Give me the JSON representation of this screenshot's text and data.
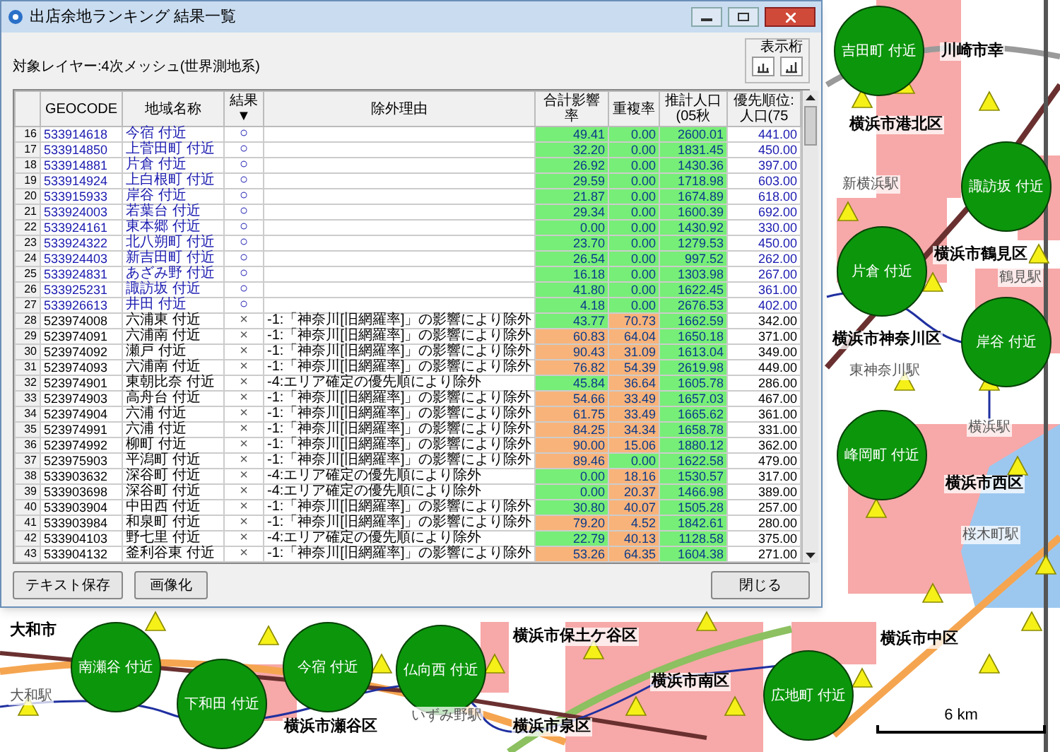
{
  "window": {
    "title": "出店余地ランキング 結果一覧"
  },
  "layer_label": "対象レイヤー:4次メッシュ(世界測地系)",
  "digits_group": {
    "label": "表示桁"
  },
  "table": {
    "columns": [
      "GEOCODE",
      "地域名称",
      "結果▼",
      "除外理由",
      "合計影響率",
      "重複率",
      "推計人口(05秋",
      "優先順位:人口(75"
    ],
    "rows": [
      {
        "no": "16",
        "kind": "adopted",
        "geocode": "533914618",
        "name": "今宿 付近",
        "result": "○",
        "impact": {
          "text": "49.41",
          "color": "#77ee77"
        },
        "overlap": {
          "text": "0.00",
          "color": "#77ee77"
        },
        "population": {
          "text": "2600.01",
          "color": "#77ee77"
        },
        "rank": "441.00"
      },
      {
        "no": "17",
        "kind": "adopted",
        "geocode": "533914850",
        "name": "上菅田町 付近",
        "result": "○",
        "impact": {
          "text": "32.20",
          "color": "#77ee77"
        },
        "overlap": {
          "text": "0.00",
          "color": "#77ee77"
        },
        "population": {
          "text": "1831.45",
          "color": "#77ee77"
        },
        "rank": "450.00"
      },
      {
        "no": "18",
        "kind": "adopted",
        "geocode": "533914881",
        "name": "片倉 付近",
        "result": "○",
        "impact": {
          "text": "26.92",
          "color": "#77ee77"
        },
        "overlap": {
          "text": "0.00",
          "color": "#77ee77"
        },
        "population": {
          "text": "1430.36",
          "color": "#77ee77"
        },
        "rank": "397.00"
      },
      {
        "no": "19",
        "kind": "adopted",
        "geocode": "533914924",
        "name": "上白根町 付近",
        "result": "○",
        "impact": {
          "text": "29.59",
          "color": "#77ee77"
        },
        "overlap": {
          "text": "0.00",
          "color": "#77ee77"
        },
        "population": {
          "text": "1718.98",
          "color": "#77ee77"
        },
        "rank": "603.00"
      },
      {
        "no": "20",
        "kind": "adopted",
        "geocode": "533915933",
        "name": "岸谷 付近",
        "result": "○",
        "impact": {
          "text": "21.87",
          "color": "#77ee77"
        },
        "overlap": {
          "text": "0.00",
          "color": "#77ee77"
        },
        "population": {
          "text": "1674.89",
          "color": "#77ee77"
        },
        "rank": "618.00"
      },
      {
        "no": "21",
        "kind": "adopted",
        "geocode": "533924003",
        "name": "若葉台 付近",
        "result": "○",
        "impact": {
          "text": "29.34",
          "color": "#77ee77"
        },
        "overlap": {
          "text": "0.00",
          "color": "#77ee77"
        },
        "population": {
          "text": "1600.39",
          "color": "#77ee77"
        },
        "rank": "692.00"
      },
      {
        "no": "22",
        "kind": "adopted",
        "geocode": "533924161",
        "name": "東本郷 付近",
        "result": "○",
        "impact": {
          "text": "0.00",
          "color": "#77ee77"
        },
        "overlap": {
          "text": "0.00",
          "color": "#77ee77"
        },
        "population": {
          "text": "1430.92",
          "color": "#77ee77"
        },
        "rank": "330.00"
      },
      {
        "no": "23",
        "kind": "adopted",
        "geocode": "533924322",
        "name": "北八朔町 付近",
        "result": "○",
        "impact": {
          "text": "23.70",
          "color": "#77ee77"
        },
        "overlap": {
          "text": "0.00",
          "color": "#77ee77"
        },
        "population": {
          "text": "1279.53",
          "color": "#77ee77"
        },
        "rank": "450.00"
      },
      {
        "no": "24",
        "kind": "adopted",
        "geocode": "533924403",
        "name": "新吉田町 付近",
        "result": "○",
        "impact": {
          "text": "26.54",
          "color": "#77ee77"
        },
        "overlap": {
          "text": "0.00",
          "color": "#77ee77"
        },
        "population": {
          "text": "997.52",
          "color": "#77ee77"
        },
        "rank": "262.00"
      },
      {
        "no": "25",
        "kind": "adopted",
        "geocode": "533924831",
        "name": "あざみ野 付近",
        "result": "○",
        "impact": {
          "text": "16.18",
          "color": "#77ee77"
        },
        "overlap": {
          "text": "0.00",
          "color": "#77ee77"
        },
        "population": {
          "text": "1303.98",
          "color": "#77ee77"
        },
        "rank": "267.00"
      },
      {
        "no": "26",
        "kind": "adopted",
        "geocode": "533925231",
        "name": "諏訪坂 付近",
        "result": "○",
        "impact": {
          "text": "41.80",
          "color": "#77ee77"
        },
        "overlap": {
          "text": "0.00",
          "color": "#77ee77"
        },
        "population": {
          "text": "1622.45",
          "color": "#77ee77"
        },
        "rank": "361.00"
      },
      {
        "no": "27",
        "kind": "adopted",
        "geocode": "533926613",
        "name": "井田 付近",
        "result": "○",
        "impact": {
          "text": "4.18",
          "color": "#77ee77"
        },
        "overlap": {
          "text": "0.00",
          "color": "#77ee77"
        },
        "population": {
          "text": "2676.53",
          "color": "#77ee77"
        },
        "rank": "402.00"
      },
      {
        "no": "28",
        "kind": "excluded",
        "geocode": "523974008",
        "name": "六浦東 付近",
        "result": "×",
        "reason": "-1:「神奈川[旧網羅率]」の影響により除外",
        "impact": {
          "text": "43.77",
          "color": "#77ee77"
        },
        "overlap": {
          "text": "70.73",
          "color": "#f8b37a"
        },
        "population": {
          "text": "1662.59",
          "color": "#77ee77"
        },
        "rank": "342.00"
      },
      {
        "no": "29",
        "kind": "excluded",
        "geocode": "523974091",
        "name": "六浦南 付近",
        "result": "×",
        "reason": "-1:「神奈川[旧網羅率]」の影響により除外",
        "impact": {
          "text": "60.83",
          "color": "#f8b37a"
        },
        "overlap": {
          "text": "64.04",
          "color": "#f8b37a"
        },
        "population": {
          "text": "1650.18",
          "color": "#77ee77"
        },
        "rank": "371.00"
      },
      {
        "no": "30",
        "kind": "excluded",
        "geocode": "523974092",
        "name": "瀬戸 付近",
        "result": "×",
        "reason": "-1:「神奈川[旧網羅率]」の影響により除外",
        "impact": {
          "text": "90.43",
          "color": "#f8b37a"
        },
        "overlap": {
          "text": "31.09",
          "color": "#f8b37a"
        },
        "population": {
          "text": "1613.04",
          "color": "#77ee77"
        },
        "rank": "349.00"
      },
      {
        "no": "31",
        "kind": "excluded",
        "geocode": "523974093",
        "name": "六浦南 付近",
        "result": "×",
        "reason": "-1:「神奈川[旧網羅率]」の影響により除外",
        "impact": {
          "text": "76.82",
          "color": "#f8b37a"
        },
        "overlap": {
          "text": "54.39",
          "color": "#f8b37a"
        },
        "population": {
          "text": "2619.98",
          "color": "#77ee77"
        },
        "rank": "449.00"
      },
      {
        "no": "32",
        "kind": "excluded",
        "geocode": "523974901",
        "name": "東朝比奈 付近",
        "result": "×",
        "reason": "-4:エリア確定の優先順により除外",
        "impact": {
          "text": "45.84",
          "color": "#77ee77"
        },
        "overlap": {
          "text": "36.64",
          "color": "#f8b37a"
        },
        "population": {
          "text": "1605.78",
          "color": "#77ee77"
        },
        "rank": "286.00"
      },
      {
        "no": "33",
        "kind": "excluded",
        "geocode": "523974903",
        "name": "高舟台 付近",
        "result": "×",
        "reason": "-1:「神奈川[旧網羅率]」の影響により除外",
        "impact": {
          "text": "54.66",
          "color": "#f8b37a"
        },
        "overlap": {
          "text": "33.49",
          "color": "#f8b37a"
        },
        "population": {
          "text": "1657.03",
          "color": "#77ee77"
        },
        "rank": "467.00"
      },
      {
        "no": "34",
        "kind": "excluded",
        "geocode": "523974904",
        "name": "六浦 付近",
        "result": "×",
        "reason": "-1:「神奈川[旧網羅率]」の影響により除外",
        "impact": {
          "text": "61.75",
          "color": "#f8b37a"
        },
        "overlap": {
          "text": "33.49",
          "color": "#f8b37a"
        },
        "population": {
          "text": "1665.62",
          "color": "#77ee77"
        },
        "rank": "361.00"
      },
      {
        "no": "35",
        "kind": "excluded",
        "geocode": "523974991",
        "name": "六浦 付近",
        "result": "×",
        "reason": "-1:「神奈川[旧網羅率]」の影響により除外",
        "impact": {
          "text": "84.25",
          "color": "#f8b37a"
        },
        "overlap": {
          "text": "34.34",
          "color": "#f8b37a"
        },
        "population": {
          "text": "1658.78",
          "color": "#77ee77"
        },
        "rank": "331.00"
      },
      {
        "no": "36",
        "kind": "excluded",
        "geocode": "523974992",
        "name": "柳町 付近",
        "result": "×",
        "reason": "-1:「神奈川[旧網羅率]」の影響により除外",
        "impact": {
          "text": "90.00",
          "color": "#f8b37a"
        },
        "overlap": {
          "text": "15.06",
          "color": "#f8b37a"
        },
        "population": {
          "text": "1880.12",
          "color": "#77ee77"
        },
        "rank": "362.00"
      },
      {
        "no": "37",
        "kind": "excluded",
        "geocode": "523975903",
        "name": "平潟町 付近",
        "result": "×",
        "reason": "-1:「神奈川[旧網羅率]」の影響により除外",
        "impact": {
          "text": "89.46",
          "color": "#f8b37a"
        },
        "overlap": {
          "text": "0.00",
          "color": "#77ee77"
        },
        "population": {
          "text": "1622.58",
          "color": "#77ee77"
        },
        "rank": "479.00"
      },
      {
        "no": "38",
        "kind": "excluded",
        "geocode": "533903632",
        "name": "深谷町 付近",
        "result": "×",
        "reason": "-4:エリア確定の優先順により除外",
        "impact": {
          "text": "0.00",
          "color": "#77ee77"
        },
        "overlap": {
          "text": "18.16",
          "color": "#f8b37a"
        },
        "population": {
          "text": "1530.57",
          "color": "#77ee77"
        },
        "rank": "317.00"
      },
      {
        "no": "39",
        "kind": "excluded",
        "geocode": "533903698",
        "name": "深谷町 付近",
        "result": "×",
        "reason": "-4:エリア確定の優先順により除外",
        "impact": {
          "text": "0.00",
          "color": "#77ee77"
        },
        "overlap": {
          "text": "20.37",
          "color": "#f8b37a"
        },
        "population": {
          "text": "1466.98",
          "color": "#77ee77"
        },
        "rank": "389.00"
      },
      {
        "no": "40",
        "kind": "excluded",
        "geocode": "533903904",
        "name": "中田西 付近",
        "result": "×",
        "reason": "-1:「神奈川[旧網羅率]」の影響により除外",
        "impact": {
          "text": "30.80",
          "color": "#77ee77"
        },
        "overlap": {
          "text": "40.07",
          "color": "#f8b37a"
        },
        "population": {
          "text": "1505.28",
          "color": "#77ee77"
        },
        "rank": "257.00"
      },
      {
        "no": "41",
        "kind": "excluded",
        "geocode": "533903984",
        "name": "和泉町 付近",
        "result": "×",
        "reason": "-1:「神奈川[旧網羅率]」の影響により除外",
        "impact": {
          "text": "79.20",
          "color": "#f8b37a"
        },
        "overlap": {
          "text": "4.52",
          "color": "#f8b37a"
        },
        "population": {
          "text": "1842.61",
          "color": "#77ee77"
        },
        "rank": "280.00"
      },
      {
        "no": "42",
        "kind": "excluded",
        "geocode": "533904103",
        "name": "野七里 付近",
        "result": "×",
        "reason": "-4:エリア確定の優先順により除外",
        "impact": {
          "text": "22.79",
          "color": "#77ee77"
        },
        "overlap": {
          "text": "40.13",
          "color": "#f8b37a"
        },
        "population": {
          "text": "1128.58",
          "color": "#77ee77"
        },
        "rank": "375.00"
      },
      {
        "no": "43",
        "kind": "excluded",
        "geocode": "533904132",
        "name": "釜利谷東 付近",
        "result": "×",
        "reason": "-1:「神奈川[旧網羅率]」の影響により除外",
        "impact": {
          "text": "53.26",
          "color": "#f8b37a"
        },
        "overlap": {
          "text": "64.35",
          "color": "#f8b37a"
        },
        "population": {
          "text": "1604.38",
          "color": "#77ee77"
        },
        "rank": "271.00"
      }
    ]
  },
  "buttons": [
    "テキスト保存",
    "画像化",
    "閉じる"
  ],
  "map": {
    "area_markers": [
      "吉田町 付近",
      "諏訪坂 付近",
      "片倉 付近",
      "岸谷 付近",
      "峰岡町 付近",
      "南瀬谷 付近",
      "下和田 付近",
      "今宿 付近",
      "仏向西 付近",
      "広地町 付近"
    ],
    "labels": [
      {
        "text": "川崎市幸",
        "kind": "district"
      },
      {
        "text": "横浜市港北区",
        "kind": "district"
      },
      {
        "text": "新横浜駅",
        "kind": "station"
      },
      {
        "text": "横浜市鶴見区",
        "kind": "district"
      },
      {
        "text": "鶴見駅",
        "kind": "station"
      },
      {
        "text": "横浜市神奈川区",
        "kind": "district"
      },
      {
        "text": "東神奈川駅",
        "kind": "station"
      },
      {
        "text": "横浜駅",
        "kind": "station"
      },
      {
        "text": "横浜市西区",
        "kind": "district"
      },
      {
        "text": "桜木町駅",
        "kind": "station"
      },
      {
        "text": "大和市",
        "kind": "district"
      },
      {
        "text": "大和駅",
        "kind": "station"
      },
      {
        "text": "横浜市瀬谷区",
        "kind": "district"
      },
      {
        "text": "いずみ野駅",
        "kind": "station"
      },
      {
        "text": "横浜市泉区",
        "kind": "district"
      },
      {
        "text": "横浜市保土ケ谷区",
        "kind": "district"
      },
      {
        "text": "横浜市南区",
        "kind": "district"
      },
      {
        "text": "横浜市中区",
        "kind": "district"
      }
    ],
    "scale": "6 km"
  }
}
